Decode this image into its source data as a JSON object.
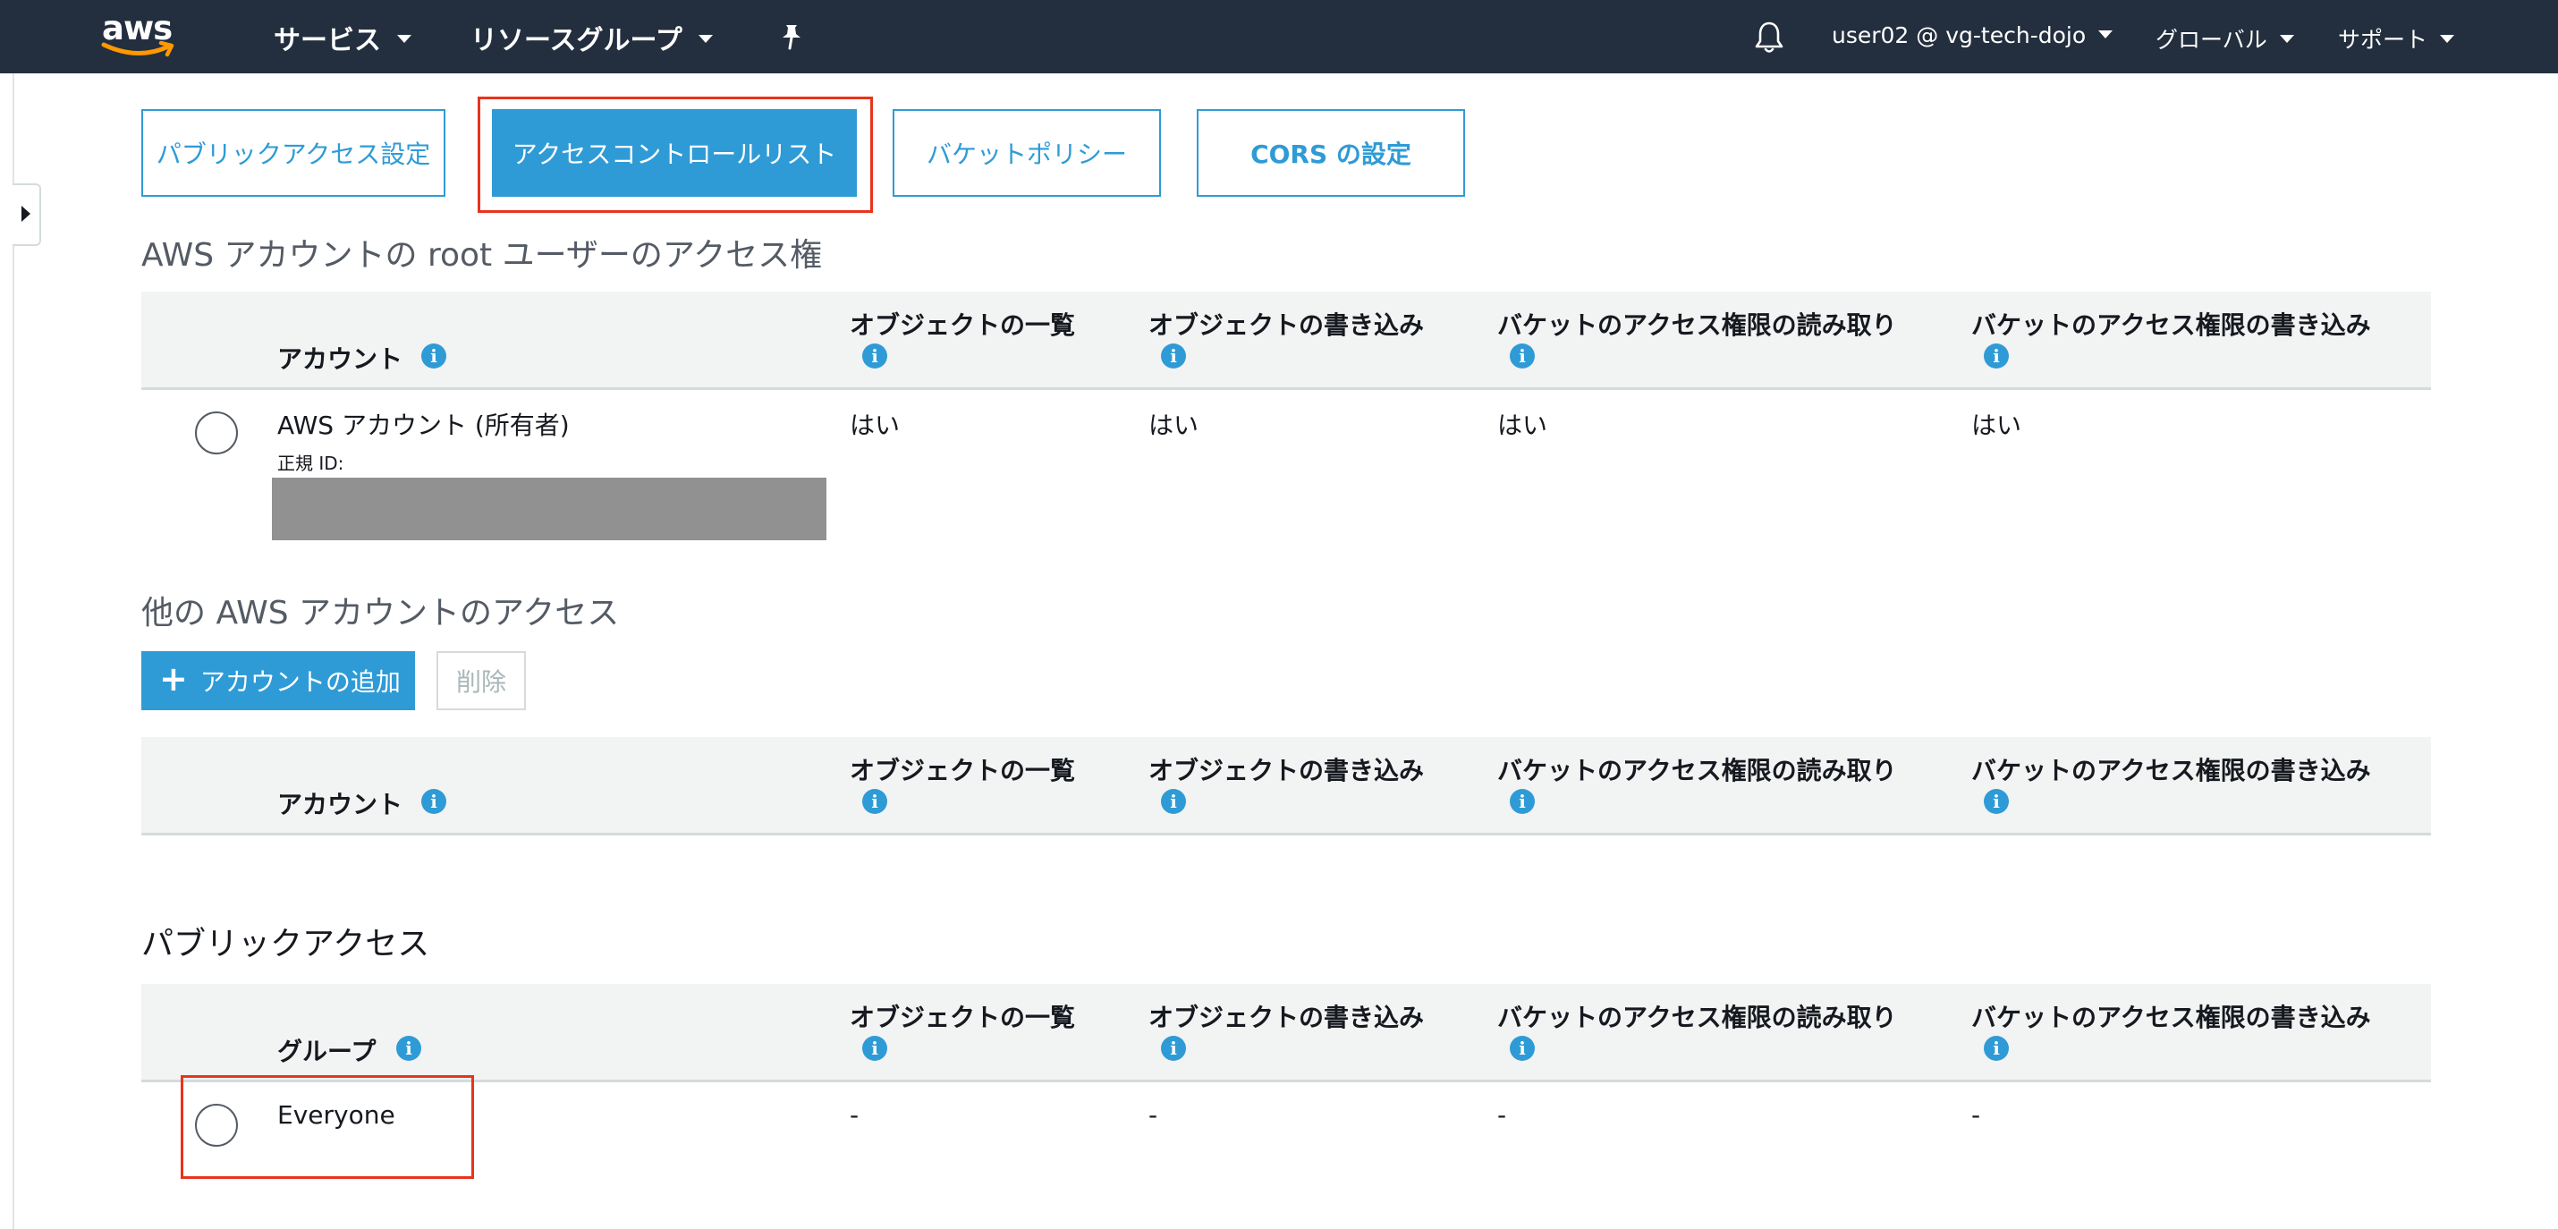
{
  "topnav": {
    "logo_text": "aws",
    "services_label": "サービス",
    "resource_groups_label": "リソースグループ",
    "pin_icon": "pushpin-icon",
    "bell_icon": "bell-icon",
    "account_label": "user02 @ vg-tech-dojo",
    "region_label": "グローバル",
    "support_label": "サポート"
  },
  "tabs": [
    {
      "label": "パブリックアクセス設定",
      "active": false
    },
    {
      "label": "アクセスコントロールリスト",
      "active": true
    },
    {
      "label": "バケットポリシー",
      "active": false
    },
    {
      "label": "CORS の設定",
      "active": false
    }
  ],
  "columns": {
    "list_objects": "オブジェクトの一覧",
    "write_objects": "オブジェクトの書き込み",
    "read_bucket_acl": "バケットのアクセス権限の読み取り",
    "write_bucket_acl": "バケットのアクセス権限の書き込み"
  },
  "root_section": {
    "title": "AWS アカウントの root ユーザーのアクセス権",
    "first_col": "アカウント",
    "row": {
      "account": "AWS アカウント (所有者)",
      "canonical_id_label": "正規 ID:",
      "list_objects": "はい",
      "write_objects": "はい",
      "read_bucket_acl": "はい",
      "write_bucket_acl": "はい"
    }
  },
  "other_section": {
    "title": "他の AWS アカウントのアクセス",
    "add_button": "アカウントの追加",
    "delete_button": "削除",
    "first_col": "アカウント"
  },
  "public_section": {
    "title": "パブリックアクセス",
    "first_col": "グループ",
    "row": {
      "group": "Everyone",
      "list_objects": "-",
      "write_objects": "-",
      "read_bucket_acl": "-",
      "write_bucket_acl": "-"
    }
  },
  "colors": {
    "nav_bg": "#232f3e",
    "accent": "#2f9bd6",
    "highlight": "#e8341c",
    "aws_orange": "#ff9900"
  }
}
